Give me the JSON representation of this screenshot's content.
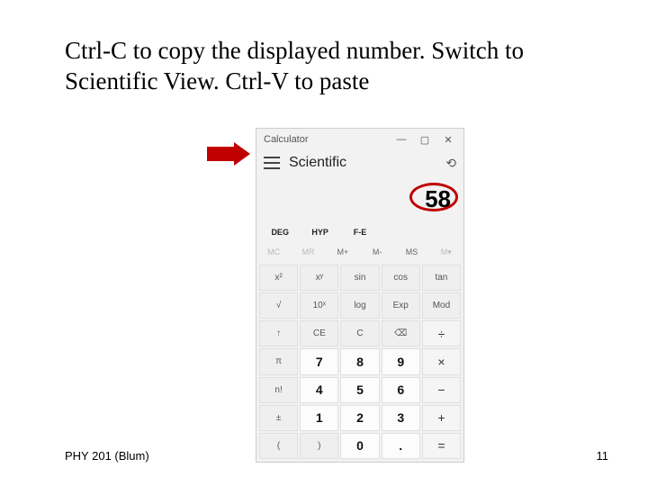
{
  "slide": {
    "title": "Ctrl-C to copy the displayed number. Switch to Scientific View. Ctrl-V to paste",
    "footer_left": "PHY 201 (Blum)",
    "page_number": "11"
  },
  "calc": {
    "app_title": "Calculator",
    "win": {
      "min": "—",
      "max": "▢",
      "close": "✕"
    },
    "mode": "Scientific",
    "history_icon": "⟲",
    "display": "58",
    "toggles": {
      "deg": "DEG",
      "hyp": "HYP",
      "fe": "F-E"
    },
    "memory": {
      "mc": "MC",
      "mr": "MR",
      "mplus": "M+",
      "mminus": "M-",
      "ms": "MS",
      "mlist": "M▾"
    },
    "keys": {
      "r0": [
        "x²",
        "xʸ",
        "sin",
        "cos",
        "tan"
      ],
      "r1": [
        "√",
        "10ˣ",
        "log",
        "Exp",
        "Mod"
      ],
      "r2": [
        "↑",
        "CE",
        "C",
        "⌫",
        "÷"
      ],
      "r3": [
        "π",
        "7",
        "8",
        "9",
        "×"
      ],
      "r4": [
        "n!",
        "4",
        "5",
        "6",
        "−"
      ],
      "r5": [
        "±",
        "1",
        "2",
        "3",
        "+"
      ],
      "r6": [
        "(",
        ")",
        "0",
        ".",
        "="
      ]
    }
  }
}
